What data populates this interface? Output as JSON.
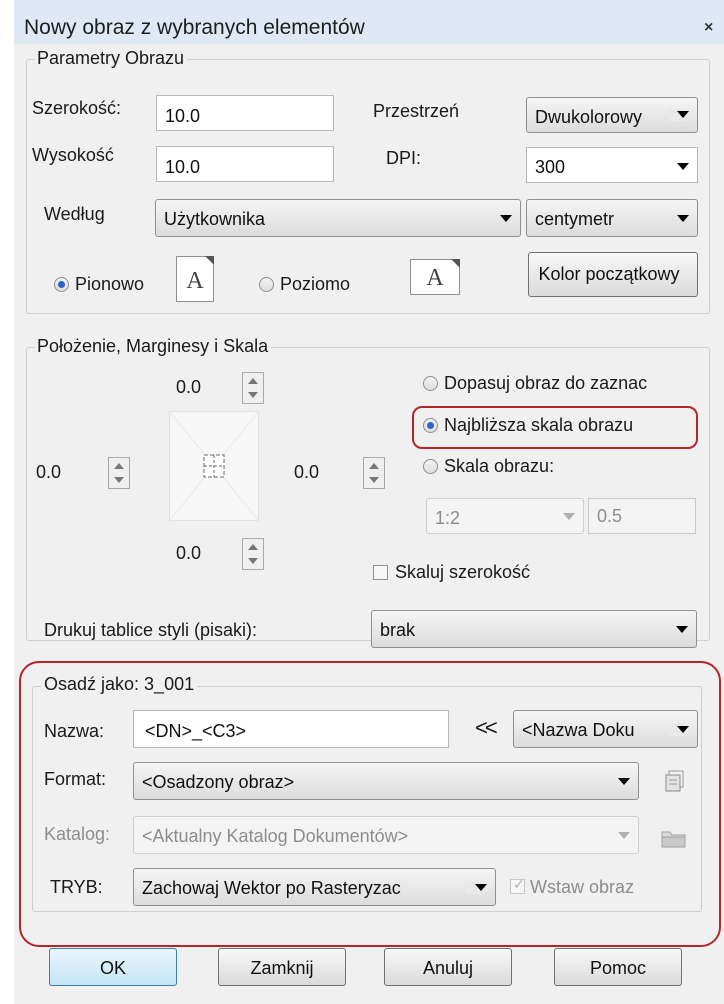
{
  "window": {
    "title": "Nowy obraz z wybranych elementów",
    "close_glyph": "×"
  },
  "image_params": {
    "legend": "Parametry Obrazu",
    "width_label": "Szerokość:",
    "width_value": "10.0",
    "height_label": "Wysokość",
    "height_value": "10.0",
    "space_label": "Przestrzeń",
    "space_value": "Dwukolorowy",
    "dpi_label": "DPI:",
    "dpi_value": "300",
    "by_label": "Według",
    "by_value": "Użytkownika",
    "unit_value": "centymetr",
    "portrait_label": "Pionowo",
    "landscape_label": "Poziomo",
    "page_glyph": "A",
    "color_button": "Kolor początkowy",
    "orientation_selected": "portrait"
  },
  "position": {
    "legend": "Położenie, Marginesy i Skala",
    "top_value": "0.0",
    "left_value": "0.0",
    "right_value": "0.0",
    "bottom_value": "0.0",
    "fit_label": "Dopasuj obraz do zaznac",
    "nearest_label": "Najbliższa skala obrazu",
    "scale_label": "Skala obrazu:",
    "scale_combo_value": "1:2",
    "scale_value": "0.5",
    "scale_width_label": "Skaluj szerokość",
    "style_table_label": "Drukuj tablice styli (pisaki):",
    "style_table_value": "brak",
    "selected_mode": "nearest"
  },
  "embed": {
    "legend": "Osadź jako: 3_001",
    "name_label": "Nazwa:",
    "name_value": "<DN>_<C3>",
    "insert_glyph": "<<",
    "name_combo_value": "<Nazwa Doku",
    "format_label": "Format:",
    "format_value": "<Osadzony obraz>",
    "catalog_label": "Katalog:",
    "catalog_value": "<Aktualny Katalog Dokumentów>",
    "mode_label": "TRYB:",
    "mode_value": "Zachowaj Wektor po Rasteryzac",
    "insert_image_label": "Wstaw obraz",
    "insert_image_checked": true
  },
  "buttons": {
    "ok": "OK",
    "close": "Zamknij",
    "cancel": "Anuluj",
    "help": "Pomoc"
  },
  "colors": {
    "highlight": "#b5262b",
    "titlebar": "#dfe9f5",
    "radio_dot": "#2a64c5"
  }
}
